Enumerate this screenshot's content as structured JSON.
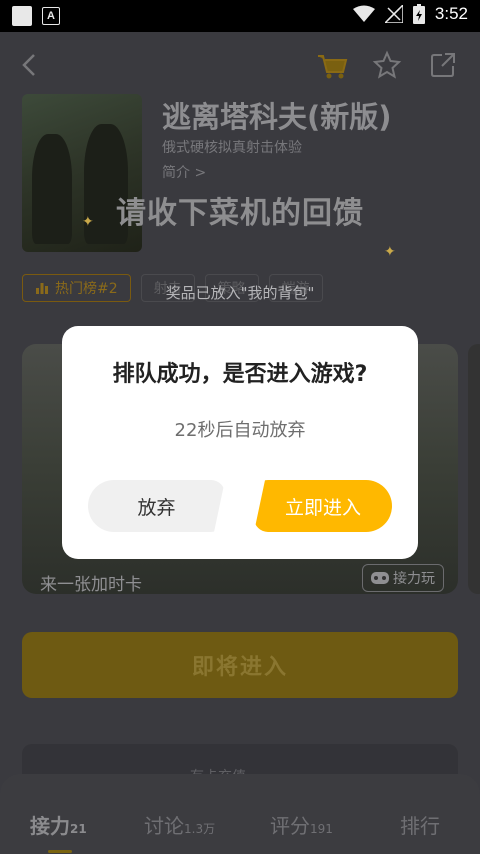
{
  "status_bar": {
    "time": "3:52"
  },
  "game": {
    "title": "逃离塔科夫(新版)",
    "subtitle": "俄式硬核拟真射击体验",
    "intro_link": "简介 >"
  },
  "tags": [
    {
      "label": "热门榜#2"
    },
    {
      "label": "射击"
    },
    {
      "label": "策略"
    },
    {
      "label": "端游"
    }
  ],
  "reward_toast": {
    "title": "请收下菜机的回馈",
    "message": "奖品已放入\"我的背包\""
  },
  "banner": {
    "caption": "来一张加时卡",
    "relay_button": "接力玩"
  },
  "enter_button": "即将进入",
  "card_hint": "有卡充值",
  "tabs": [
    {
      "label": "接力",
      "count": "21"
    },
    {
      "label": "讨论",
      "count": "1.3万"
    },
    {
      "label": "评分",
      "count": "191"
    },
    {
      "label": "排行",
      "count": ""
    }
  ],
  "modal": {
    "title": "排队成功，是否进入游戏?",
    "countdown": "22秒后自动放弃",
    "cancel_label": "放弃",
    "enter_label": "立即进入"
  },
  "colors": {
    "accent": "#ffb800",
    "overlay_bg": "#2b2b2e",
    "modal_bg": "#ffffff"
  }
}
